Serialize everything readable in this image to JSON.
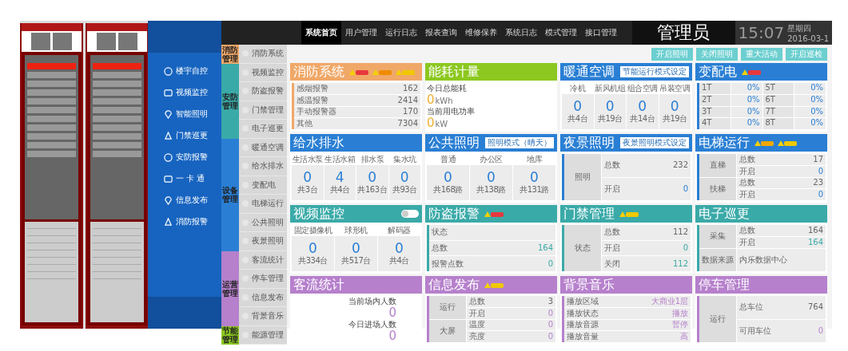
{
  "nav": {
    "items": [
      {
        "label": "系统首页",
        "selected": true
      },
      {
        "label": "用户管理",
        "selected": false
      },
      {
        "label": "运行日志",
        "selected": false
      },
      {
        "label": "报表查询",
        "selected": false
      },
      {
        "label": "维修保养",
        "selected": false
      },
      {
        "label": "系统日志",
        "selected": false
      },
      {
        "label": "模式管理",
        "selected": false
      },
      {
        "label": "接口管理",
        "selected": false
      }
    ]
  },
  "user": "管理员",
  "clock": {
    "time": "15:07",
    "weekday": "星期四",
    "date": "2016-03-1"
  },
  "launcher": {
    "items": [
      "楼宇自控",
      "视频监控",
      "智能照明",
      "门禁巡更",
      "安防报警",
      "一 卡 通",
      "信息发布",
      "消防报警"
    ]
  },
  "categories": [
    {
      "label": "消防管理",
      "color": "#f0a868",
      "items": [
        "消防系统"
      ]
    },
    {
      "label": "安防管理",
      "color": "#3aaaa8",
      "items": [
        "视频监控",
        "防盗报警",
        "门禁管理",
        "电子巡更"
      ]
    },
    {
      "label": "设备管理",
      "color": "#2a7fd4",
      "items": [
        "暖通空调",
        "给水排水",
        "变配电",
        "电梯运行",
        "公共照明",
        "夜景照明"
      ]
    },
    {
      "label": "运营管理",
      "color": "#b680cc",
      "items": [
        "客流统计",
        "停车管理",
        "信息发布",
        "背景音乐"
      ]
    },
    {
      "label": "节能管理",
      "color": "#8cc820",
      "items": [
        "能源管理"
      ]
    }
  ],
  "actions": [
    "开启照明",
    "关闭照明",
    "重大活动",
    "开启巡检"
  ],
  "cards": [
    {
      "title": "消防系统",
      "color": "#f0a868",
      "kind": "list",
      "alarm_badges": [
        {
          "color": "#e8383d"
        },
        {
          "color": "#f08c00"
        },
        {
          "color": "#f0c800"
        }
      ],
      "rows": [
        {
          "label": "感烟报警",
          "value": "162",
          "highlight": false
        },
        {
          "label": "感温报警",
          "value": "2414",
          "highlight": false
        },
        {
          "label": "手动报警器",
          "value": "170",
          "highlight": false
        },
        {
          "label": "其他",
          "value": "7304",
          "highlight": false
        }
      ]
    },
    {
      "title": "能耗计量",
      "color": "#8cc820",
      "kind": "readings",
      "readings": [
        {
          "label": "今日总能耗",
          "value": "0",
          "unit": "kWh"
        },
        {
          "label": "当前用电功率",
          "value": "0",
          "unit": "kW"
        }
      ]
    },
    {
      "title": "暖通空调",
      "color": "#2a7fd4",
      "kind": "meters",
      "selector": "节能运行模式设定",
      "meters": [
        {
          "label": "冷机",
          "value": "0",
          "note": "共4台"
        },
        {
          "label": "新风机组",
          "value": "0",
          "note": "共19台"
        },
        {
          "label": "组合空调",
          "value": "0",
          "note": "共14台"
        },
        {
          "label": "吊装空调",
          "value": "0",
          "note": "共19台"
        }
      ]
    },
    {
      "title": "变配电",
      "color": "#2a7fd4",
      "kind": "grid",
      "alarm_badges": [
        {
          "color": "#e8383d"
        }
      ],
      "cells": [
        {
          "label": "1T",
          "value": "0%"
        },
        {
          "label": "5T",
          "value": "0%"
        },
        {
          "label": "2T",
          "value": "0%"
        },
        {
          "label": "6T",
          "value": "0%"
        },
        {
          "label": "3T",
          "value": "0%"
        },
        {
          "label": "7T",
          "value": "0%"
        },
        {
          "label": "4T",
          "value": "0%"
        },
        {
          "label": "8T",
          "value": "0%"
        }
      ]
    },
    {
      "title": "给水排水",
      "color": "#2a7fd4",
      "kind": "meters",
      "meters": [
        {
          "label": "生活水泵",
          "value": "0",
          "note": "共3台"
        },
        {
          "label": "生活水箱",
          "value": "4",
          "note": "共4台"
        },
        {
          "label": "排水泵",
          "value": "0",
          "note": "共163台"
        },
        {
          "label": "集水坑",
          "value": "0",
          "note": "共93台"
        }
      ]
    },
    {
      "title": "公共照明",
      "color": "#2a7fd4",
      "kind": "meters",
      "selector": "照明模式（晴天）",
      "meters": [
        {
          "label": "普通",
          "value": "0",
          "note": "共168路"
        },
        {
          "label": "办公区",
          "value": "0",
          "note": "共138路"
        },
        {
          "label": "地库",
          "value": "0",
          "note": "共131路"
        }
      ]
    },
    {
      "title": "夜景照明",
      "color": "#2a7fd4",
      "kind": "groups",
      "selector": "夜景照明模式设定",
      "groups": [
        {
          "label": "照明",
          "rows": [
            {
              "label": "总数",
              "value": "232",
              "highlight": false
            },
            {
              "label": "开启",
              "value": "0",
              "highlight": true
            }
          ]
        }
      ]
    },
    {
      "title": "电梯运行",
      "color": "#2a7fd4",
      "kind": "groups",
      "alarm_badges": [
        {
          "color": "#f0a800"
        },
        {
          "color": "#f0c800"
        }
      ],
      "groups": [
        {
          "label": "直梯",
          "rows": [
            {
              "label": "总数",
              "value": "17",
              "highlight": false
            },
            {
              "label": "开启",
              "value": "0",
              "highlight": true
            }
          ]
        },
        {
          "label": "扶梯",
          "rows": [
            {
              "label": "总数",
              "value": "23",
              "highlight": false
            },
            {
              "label": "开启",
              "value": "0",
              "highlight": true
            }
          ]
        }
      ]
    },
    {
      "title": "视频监控",
      "color": "#3aaaa8",
      "kind": "meters",
      "toggle_on": false,
      "meters": [
        {
          "label": "固定摄像机",
          "value": "0",
          "note": "共334台"
        },
        {
          "label": "球形机",
          "value": "0",
          "note": "共517台"
        },
        {
          "label": "解码器",
          "value": "0",
          "note": "共4台"
        }
      ]
    },
    {
      "title": "防盗报警",
      "color": "#3aaaa8",
      "kind": "list",
      "alarm_badges": [
        {
          "color": "#e8383d"
        }
      ],
      "rows": [
        {
          "label": "状态"
        },
        {
          "label": "总数",
          "value": "164",
          "highlight": true
        },
        {
          "label": "报警点数",
          "value": "0",
          "highlight": true
        }
      ]
    },
    {
      "title": "门禁管理",
      "color": "#3aaaa8",
      "kind": "groups",
      "alarm_badges": [
        {
          "color": "#f0c800"
        }
      ],
      "groups": [
        {
          "label": "状态",
          "rows": [
            {
              "label": "总数",
              "value": "112",
              "highlight": false
            },
            {
              "label": "开启",
              "value": "0",
              "highlight": true
            },
            {
              "label": "关闭",
              "value": "112",
              "highlight": true
            }
          ]
        }
      ]
    },
    {
      "title": "电子巡更",
      "color": "#3aaaa8",
      "kind": "groups",
      "groups": [
        {
          "label": "采集",
          "rows": [
            {
              "label": "总数",
              "value": "164",
              "highlight": false
            },
            {
              "label": "开启",
              "value": "164",
              "highlight": true
            }
          ]
        },
        {
          "label": "数据来源",
          "rows": [
            {
              "label": "",
              "value": "内乐数据中心",
              "highlight": false
            }
          ]
        }
      ]
    },
    {
      "title": "客流统计",
      "color": "#b680cc",
      "kind": "counts",
      "readings": [
        {
          "label": "当前场内人数",
          "value": "0"
        },
        {
          "label": "今日进场人数",
          "value": "0"
        }
      ]
    },
    {
      "title": "信息发布",
      "color": "#b680cc",
      "kind": "groups",
      "alarm_badges": [
        {
          "color": "#f0c800"
        }
      ],
      "groups": [
        {
          "label": "运行",
          "rows": [
            {
              "label": "总数",
              "value": "3",
              "highlight": false
            },
            {
              "label": "开启",
              "value": "0",
              "highlight": true
            }
          ]
        },
        {
          "label": "大屏",
          "rows": [
            {
              "label": "温度",
              "value": "0",
              "highlight": true
            },
            {
              "label": "亮度",
              "value": "0",
              "highlight": true
            }
          ]
        }
      ]
    },
    {
      "title": "背景音乐",
      "color": "#b680cc",
      "kind": "list",
      "rows": [
        {
          "label": "播放区域",
          "value": "大商业1层",
          "highlight": true
        },
        {
          "label": "播放状态",
          "value": "播放",
          "highlight": true
        },
        {
          "label": "播放音源",
          "value": "暂停",
          "highlight": true
        },
        {
          "label": "播放音量",
          "value": "高",
          "highlight": true
        }
      ]
    },
    {
      "title": "停车管理",
      "color": "#b680cc",
      "kind": "groups",
      "groups": [
        {
          "label": "运行",
          "rows": [
            {
              "label": "总车位",
              "value": "764",
              "highlight": false
            },
            {
              "label": "可用车位",
              "value": "0",
              "highlight": true
            }
          ]
        }
      ]
    }
  ]
}
